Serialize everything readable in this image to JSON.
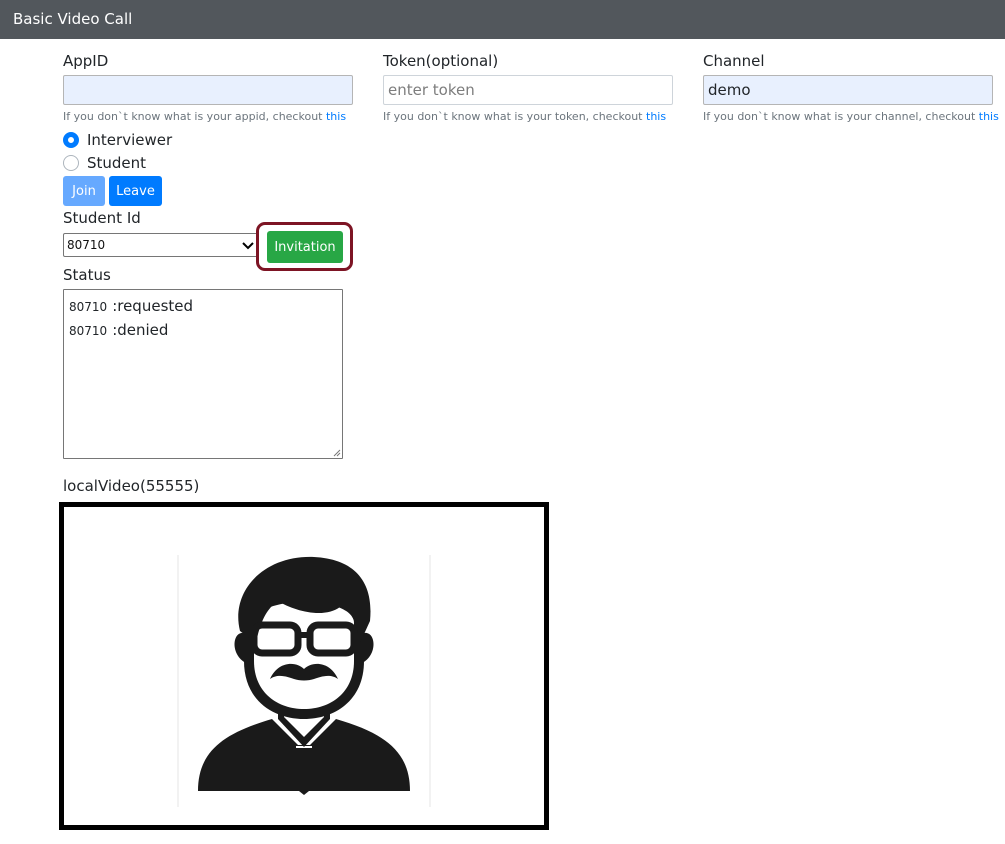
{
  "navbar": {
    "brand": "Basic Video Call"
  },
  "form": {
    "appid": {
      "label": "AppID",
      "value": "",
      "hint_text": "If you don`t know what is your appid, checkout ",
      "hint_link": "this"
    },
    "token": {
      "label": "Token(optional)",
      "placeholder": "enter token",
      "value": "",
      "hint_text": "If you don`t know what is your token, checkout ",
      "hint_link": "this"
    },
    "channel": {
      "label": "Channel",
      "value": "demo",
      "hint_text": "If you don`t know what is your channel, checkout ",
      "hint_link": "this"
    }
  },
  "roles": [
    {
      "label": "Interviewer",
      "checked": true
    },
    {
      "label": "Student",
      "checked": false
    }
  ],
  "buttons": {
    "join": "Join",
    "leave": "Leave",
    "invitation": "Invitation"
  },
  "student": {
    "label": "Student Id",
    "selected": "80710"
  },
  "status": {
    "label": "Status",
    "lines": [
      {
        "id": "80710",
        "text": ":requested"
      },
      {
        "id": "80710",
        "text": ":denied"
      }
    ]
  },
  "video": {
    "label": "localVideo(55555)"
  },
  "colors": {
    "navbar": "#52575c",
    "primary": "#007bff",
    "primary_disabled": "#66a9ff",
    "success": "#28a745",
    "highlight_ring": "#7d1424"
  },
  "icons": {
    "select": "chevron-down-icon",
    "avatar": "man-with-glasses-and-mustache-icon"
  }
}
